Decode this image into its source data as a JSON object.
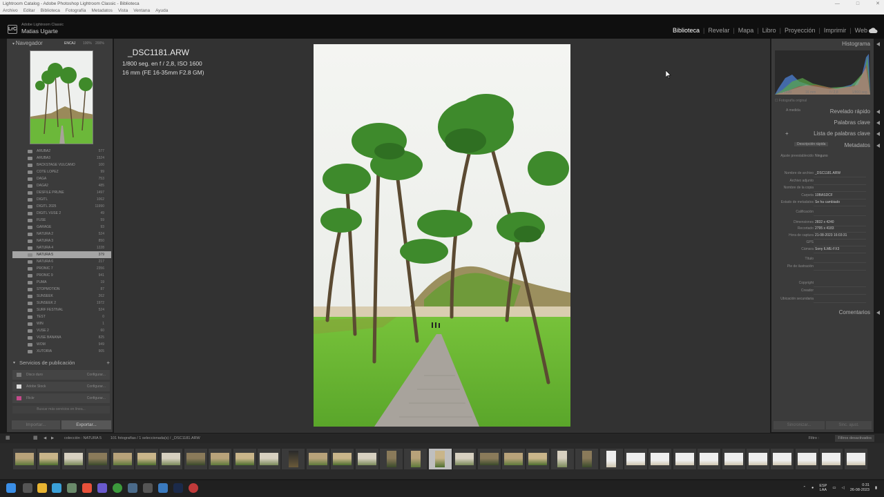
{
  "window": {
    "title": "Lightroom Catalog - Adobe Photoshop Lightroom Classic - Biblioteca"
  },
  "menu": [
    "Archivo",
    "Editar",
    "Biblioteca",
    "Fotografía",
    "Metadatos",
    "Vista",
    "Ventana",
    "Ayuda"
  ],
  "identity": {
    "app": "Adobe Lightroom Classic",
    "user": "Matias Ugarte",
    "logo": "LrC"
  },
  "modules": [
    {
      "label": "Biblioteca",
      "active": true
    },
    {
      "label": "Revelar"
    },
    {
      "label": "Mapa"
    },
    {
      "label": "Libro"
    },
    {
      "label": "Proyección"
    },
    {
      "label": "Imprimir"
    },
    {
      "label": "Web"
    }
  ],
  "navigator": {
    "title": "Navegador",
    "zoom_options": [
      "ENCAJ",
      "100%",
      "200%"
    ]
  },
  "folders": [
    {
      "name": "ARUBA2",
      "count": "577"
    },
    {
      "name": "ARUBA3",
      "count": "1524"
    },
    {
      "name": "BACKSTAGE VULCANO",
      "count": "100"
    },
    {
      "name": "COTE LOPEZ",
      "count": "99"
    },
    {
      "name": "DAGA",
      "count": "753"
    },
    {
      "name": "DAGA2",
      "count": "485"
    },
    {
      "name": "DESFILE PRUNE",
      "count": "1497"
    },
    {
      "name": "DIGITL",
      "count": "1062"
    },
    {
      "name": "DIGITL 2025",
      "count": "11990"
    },
    {
      "name": "DIGITL VUSE 2",
      "count": "49"
    },
    {
      "name": "FUSE",
      "count": "59"
    },
    {
      "name": "GARAGE",
      "count": "93"
    },
    {
      "name": "NATURA 2",
      "count": "524"
    },
    {
      "name": "NATURA 3",
      "count": "850"
    },
    {
      "name": "NATURA 4",
      "count": "1228"
    },
    {
      "name": "NATURA 5",
      "count": "379",
      "selected": true
    },
    {
      "name": "NATURA 6",
      "count": "217"
    },
    {
      "name": "PRONIC 7",
      "count": "2356"
    },
    {
      "name": "PRONIC 9",
      "count": "941"
    },
    {
      "name": "PUMA",
      "count": "19"
    },
    {
      "name": "STOPMOTION",
      "count": "87"
    },
    {
      "name": "SUNSEEK",
      "count": "262"
    },
    {
      "name": "SUNSEEK 2",
      "count": "1972"
    },
    {
      "name": "SURF FESTIVAL",
      "count": "524"
    },
    {
      "name": "TEST",
      "count": "0"
    },
    {
      "name": "WIN",
      "count": "1"
    },
    {
      "name": "VUSE 2",
      "count": "60"
    },
    {
      "name": "VUSE BANANA",
      "count": "825"
    },
    {
      "name": "WOM",
      "count": "949"
    },
    {
      "name": "XUTORIA",
      "count": "905"
    }
  ],
  "publish": {
    "title": "Servicios de publicación",
    "services": [
      {
        "name": "Disco duro",
        "action": "Configurar..."
      },
      {
        "name": "Adobe Stock",
        "action": "Configurar..."
      },
      {
        "name": "Flickr",
        "action": "Configurar..."
      }
    ],
    "find_more": "Buscar más servicios en línea..."
  },
  "buttons": {
    "import": "Importar...",
    "export": "Exportar...",
    "sync_meta": "Sincronizar...",
    "sync_settings": "Sinc. ajust."
  },
  "photo_info": {
    "filename": "_DSC1181.ARW",
    "line1": "1/800 seg. en f / 2,8, ISO 1600",
    "line2": "16 mm (FE 16-35mm F2.8 GM)"
  },
  "right": {
    "histogram": "Histograma",
    "histo_labels": [
      "ISO 1600",
      "16 mm",
      "f / 2,8",
      "1/800 seg."
    ],
    "original": "Fotografía original",
    "quick_develop": "Revelado rápido",
    "quick_develop_preset": "A medida",
    "keywording": "Palabras clave",
    "keyword_list": "Lista de palabras clave",
    "metadata": "Metadatos",
    "metadata_preset_label": "Ajuste preestablecido",
    "metadata_preset": "Ninguno",
    "metadata_view": "Descripción rápida",
    "comments": "Comentarios",
    "fields": [
      {
        "k": "Nombre de archivo",
        "v": "_DSC1181.ARW"
      },
      {
        "k": "Archivo adjunto",
        "v": ""
      },
      {
        "k": "Nombre de la copia",
        "v": ""
      },
      {
        "k": "Carpeta",
        "v": "10BASDCF"
      },
      {
        "k": "Estado de metadatos",
        "v": "Se ha cambiado"
      },
      {
        "k": "Calificación",
        "v": ""
      },
      {
        "k": "Dimensiones",
        "v": "2832 x 4240"
      },
      {
        "k": "Recortado",
        "v": "2795 x 4183"
      },
      {
        "k": "Hora de captura",
        "v": "21-08-2023 16:03:31"
      },
      {
        "k": "GPS",
        "v": ""
      },
      {
        "k": "Cámara",
        "v": "Sony ILME-FX3"
      },
      {
        "k": "Título",
        "v": ""
      },
      {
        "k": "Pie de ilustración",
        "v": ""
      },
      {
        "k": "Copyright",
        "v": ""
      },
      {
        "k": "Creador",
        "v": ""
      },
      {
        "k": "Ubicación secundaria",
        "v": ""
      }
    ]
  },
  "filmbar": {
    "source": "colección : NATURA 5",
    "count": "101 fotografías / 1 seleccionada(s) / _DSC1181.ARW",
    "filter_label": "Filtro :",
    "filter_value": "Filtros desactivados"
  },
  "taskbar": {
    "lang": "ESP",
    "region": "LAA",
    "time": "0:31",
    "date": "26-08-2023"
  }
}
